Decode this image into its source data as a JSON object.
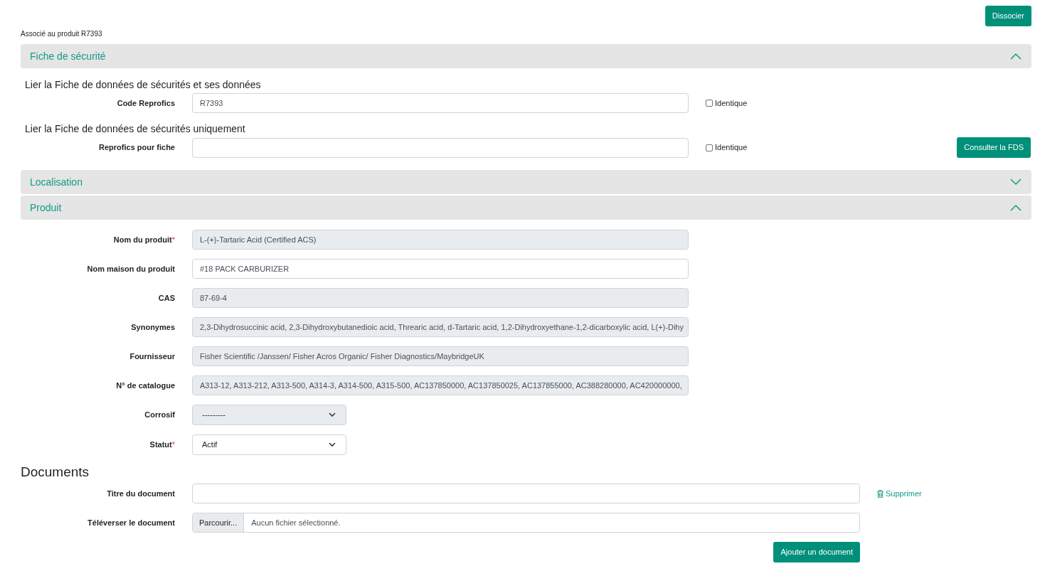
{
  "header": {
    "associated_text": "Associé au produit R7393",
    "dissociate_button": "Dissocier"
  },
  "sections": [
    {
      "title": "Fiche de sécurité",
      "expanded": true,
      "kind": "sds",
      "groups": [
        {
          "heading": "Lier la Fiche de données de sécurités et ses données",
          "label": "Code Reprofics",
          "value": "R7393",
          "checkbox": {
            "label": "Identique",
            "checked": false
          }
        },
        {
          "heading": "Lier la Fiche de données de sécurités uniquement",
          "label": "Reprofics pour fiche",
          "checkbox": {
            "label": "Identique",
            "checked": false
          },
          "button": "Consulter la FDS"
        }
      ]
    },
    {
      "title": "Localisation",
      "expanded": false
    },
    {
      "title": "Produit",
      "expanded": true,
      "kind": "fields",
      "fields": [
        {
          "kind": "text",
          "label": "Nom du produit",
          "required_mark": "*",
          "readonly": true,
          "value": "L-(+)-Tartaric Acid (Certified ACS)"
        },
        {
          "kind": "text",
          "label": "Nom maison du produit",
          "readonly": false,
          "value": "#18 PACK CARBURIZER"
        },
        {
          "kind": "text",
          "label": "CAS",
          "readonly": true,
          "value": "87-69-4"
        },
        {
          "kind": "text",
          "label": "Synonymes",
          "readonly": true,
          "value": "2,3-Dihydrosuccinic acid, 2,3-Dihydroxybutanedioic acid, Threaric acid, d-Tartaric acid, 1,2-Dihydroxyethane-1,2-dicarboxylic acid, L(+)-Dihy"
        },
        {
          "kind": "text",
          "label": "Fournisseur",
          "readonly": true,
          "value": "Fisher Scientific /Janssen/ Fisher Acros Organic/ Fisher Diagnostics/MaybridgeUK"
        },
        {
          "kind": "text",
          "label": "N° de catalogue",
          "readonly": true,
          "value": "A313-12, A313-212, A313-500, A314-3, A314-500, A315-500, AC137850000, AC137850025, AC137855000, AC388280000, AC420000000,"
        },
        {
          "kind": "select",
          "label": "Corrosif",
          "readonly": true,
          "value": "---------"
        },
        {
          "kind": "select",
          "label": "Statut",
          "required_mark": "*",
          "readonly": false,
          "value": "Actif"
        }
      ]
    }
  ],
  "documents": {
    "title": "Documents",
    "fields": [
      {
        "kind": "text",
        "label": "Titre du document"
      },
      {
        "kind": "file",
        "label": "Téléverser le document",
        "browse": "Parcourir...",
        "file_status": "Aucun fichier sélectionné."
      }
    ],
    "delete_link": "Supprimer",
    "add_button": "Ajouter un document"
  }
}
